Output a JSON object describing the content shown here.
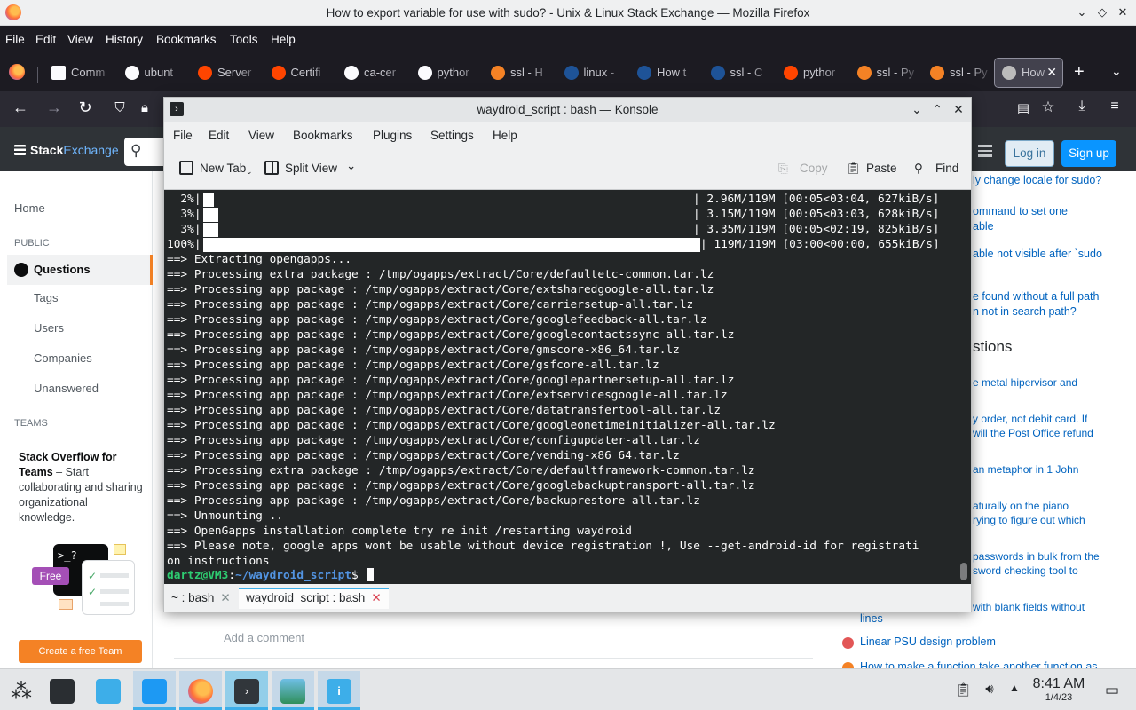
{
  "firefox": {
    "window_title": "How to export variable for use with sudo? - Unix & Linux Stack Exchange — Mozilla Firefox",
    "menu": [
      "File",
      "Edit",
      "View",
      "History",
      "Bookmarks",
      "Tools",
      "Help"
    ],
    "tabs": [
      {
        "label": "Comm",
        "favicon": "page-icon"
      },
      {
        "label": "ubunt",
        "favicon": "google-icon"
      },
      {
        "label": "Server",
        "favicon": "reddit-icon"
      },
      {
        "label": "Certifi",
        "favicon": "reddit-icon"
      },
      {
        "label": "ca-cer",
        "favicon": "google-icon"
      },
      {
        "label": "pythor",
        "favicon": "google-icon"
      },
      {
        "label": "ssl - H",
        "favicon": "stackoverflow-icon"
      },
      {
        "label": "linux -",
        "favicon": "stackexchange-icon"
      },
      {
        "label": "How t",
        "favicon": "stackexchange-icon"
      },
      {
        "label": "ssl - C",
        "favicon": "stackexchange-icon"
      },
      {
        "label": "pythor",
        "favicon": "reddit-icon"
      },
      {
        "label": "ssl - Py",
        "favicon": "stackoverflow-icon"
      },
      {
        "label": "ssl - Py",
        "favicon": "stackoverflow-icon"
      },
      {
        "label": "How",
        "favicon": "unix-se-icon",
        "active": true
      }
    ]
  },
  "stackexchange": {
    "logo_a": "Stack",
    "logo_b": "Exchange",
    "login": "Log in",
    "signup": "Sign up",
    "left_nav": {
      "home": "Home",
      "public": "PUBLIC",
      "questions": "Questions",
      "tags": "Tags",
      "users": "Users",
      "companies": "Companies",
      "unanswered": "Unanswered",
      "teams": "TEAMS",
      "teams_title": "Stack Overflow for Teams",
      "teams_text": " – Start collaborating and sharing organizational knowledge.",
      "free": "Free",
      "term_glyph": ">_?",
      "create_team": "Create a free Team"
    },
    "add_comment": "Add a comment",
    "right_links": [
      "ly change locale for sudo?",
      "ommand to set one",
      "able",
      "able not visible after `sudo",
      "e found without a full path",
      "n not in search path?"
    ],
    "hot_heading": "stions",
    "hot_fragments": [
      "e metal hipervisor and",
      "y order, not debit card. If",
      " will the Post Office refund",
      "an metaphor in 1 John",
      "aturally on the piano",
      "rying to figure out which",
      "passwords in bulk from the",
      "sword checking tool to",
      "with blank fields without",
      "lines"
    ],
    "hot_items": [
      "Linear PSU design problem",
      "How to make a function take another function as"
    ]
  },
  "konsole": {
    "window_title": "waydroid_script : bash — Konsole",
    "menu": [
      "File",
      "Edit",
      "View",
      "Bookmarks",
      "Plugins",
      "Settings",
      "Help"
    ],
    "toolbar": {
      "new_tab": "New Tab",
      "split_view": "Split View",
      "copy": "Copy",
      "paste": "Paste",
      "find": "Find"
    },
    "progress_rows": [
      {
        "pct": "  2%|",
        "fill": 0.02,
        "stats": "| 2.96M/119M [00:05<03:04, 627kiB/s]"
      },
      {
        "pct": "  3%|",
        "fill": 0.03,
        "stats": "| 3.15M/119M [00:05<03:03, 628kiB/s]"
      },
      {
        "pct": "  3%|",
        "fill": 0.03,
        "stats": "| 3.35M/119M [00:05<02:19, 825kiB/s]"
      },
      {
        "pct": "100%|",
        "fill": 1.0,
        "stats": "| 119M/119M [03:00<00:00, 655kiB/s]"
      }
    ],
    "output_lines": [
      "==> Extracting opengapps...",
      "==> Processing extra package : /tmp/ogapps/extract/Core/defaultetc-common.tar.lz",
      "==> Processing app package : /tmp/ogapps/extract/Core/extsharedgoogle-all.tar.lz",
      "==> Processing app package : /tmp/ogapps/extract/Core/carriersetup-all.tar.lz",
      "==> Processing app package : /tmp/ogapps/extract/Core/googlefeedback-all.tar.lz",
      "==> Processing app package : /tmp/ogapps/extract/Core/googlecontactssync-all.tar.lz",
      "==> Processing app package : /tmp/ogapps/extract/Core/gmscore-x86_64.tar.lz",
      "==> Processing app package : /tmp/ogapps/extract/Core/gsfcore-all.tar.lz",
      "==> Processing app package : /tmp/ogapps/extract/Core/googlepartnersetup-all.tar.lz",
      "==> Processing app package : /tmp/ogapps/extract/Core/extservicesgoogle-all.tar.lz",
      "==> Processing app package : /tmp/ogapps/extract/Core/datatransfertool-all.tar.lz",
      "==> Processing app package : /tmp/ogapps/extract/Core/googleonetimeinitializer-all.tar.lz",
      "==> Processing app package : /tmp/ogapps/extract/Core/configupdater-all.tar.lz",
      "==> Processing app package : /tmp/ogapps/extract/Core/vending-x86_64.tar.lz",
      "==> Processing extra package : /tmp/ogapps/extract/Core/defaultframework-common.tar.lz",
      "==> Processing app package : /tmp/ogapps/extract/Core/googlebackuptransport-all.tar.lz",
      "==> Processing app package : /tmp/ogapps/extract/Core/backuprestore-all.tar.lz",
      "==> Unmounting ..",
      "==> OpenGapps installation complete try re init /restarting waydroid",
      "==> Please note, google apps wont be usable without device registration !, Use --get-android-id for registrati",
      "on instructions"
    ],
    "prompt": {
      "user": "dartz@VM3",
      "sep": ":",
      "path": "~/waydroid_script",
      "symbol": "$"
    },
    "tabs": [
      {
        "label": "~ : bash",
        "active": false
      },
      {
        "label": "waydroid_script : bash",
        "active": true
      }
    ]
  },
  "taskbar": {
    "time": "8:41 AM",
    "date": "1/4/23"
  }
}
